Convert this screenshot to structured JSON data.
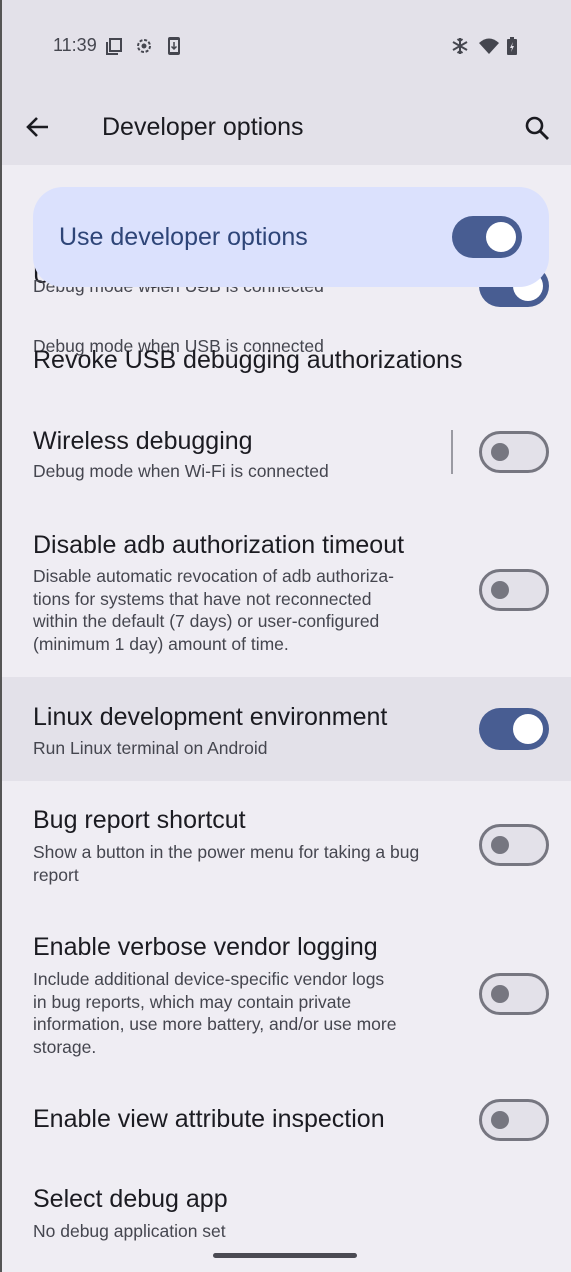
{
  "status_bar": {
    "time": "11:39",
    "left_icons": [
      "screenshot-icon",
      "settings-gear-icon",
      "download-phone-icon"
    ],
    "right_icons": [
      "snowflake-icon",
      "wifi-icon",
      "battery-charging-icon"
    ]
  },
  "app_bar": {
    "title": "Developer options",
    "back_icon": "arrow-back-icon",
    "search_icon": "search-icon"
  },
  "master_switch": {
    "label": "Use developer options",
    "checked": true
  },
  "colors": {
    "accent": "#485d92",
    "master_card_bg": "#dbe1fd",
    "highlight_bg": "#e3e1e9",
    "page_bg": "#efedf3"
  },
  "settings": [
    {
      "id": "usb-debugging",
      "title": "USB debugging",
      "summary": "Debug mode when USB is connected",
      "switch": true,
      "checked": true,
      "partially_hidden": true
    },
    {
      "id": "revoke-usb",
      "title": "Revoke USB debugging authorizations",
      "summary": null,
      "switch": false
    },
    {
      "id": "wireless-debugging",
      "title": "Wireless debugging",
      "summary": "Debug mode when Wi-Fi is connected",
      "switch": true,
      "checked": false,
      "divider": true
    },
    {
      "id": "disable-adb-timeout",
      "title": "Disable adb authorization timeout",
      "summary_lines": [
        "Disable automatic revocation of adb authoriza-",
        "tions for systems that have not reconnected",
        "within the default (7 days) or user-configured",
        "(minimum 1 day) amount of time."
      ],
      "switch": true,
      "checked": false
    },
    {
      "id": "linux-dev-env",
      "title": "Linux development environment",
      "summary": "Run Linux terminal on Android",
      "switch": true,
      "checked": true,
      "highlighted": true
    },
    {
      "id": "bug-report-shortcut",
      "title": "Bug report shortcut",
      "summary_lines": [
        "Show a button in the power menu for taking a bug",
        "report"
      ],
      "switch": true,
      "checked": false
    },
    {
      "id": "verbose-vendor-logging",
      "title": "Enable verbose vendor logging",
      "summary_lines": [
        "Include additional device-specific vendor logs",
        "in bug reports, which may contain private",
        "information, use more battery, and/or use more",
        "storage."
      ],
      "switch": true,
      "checked": false
    },
    {
      "id": "view-attribute-inspection",
      "title": "Enable view attribute inspection",
      "summary": null,
      "switch": true,
      "checked": false
    },
    {
      "id": "select-debug-app",
      "title": "Select debug app",
      "summary": "No debug application set",
      "switch": false
    }
  ]
}
